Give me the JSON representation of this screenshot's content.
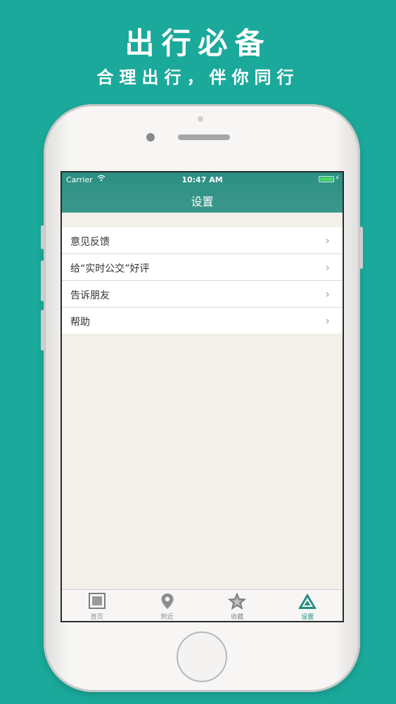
{
  "promo": {
    "headline": "出行必备",
    "subline": "合理出行，伴你同行"
  },
  "status_bar": {
    "carrier": "Carrier",
    "time": "10:47 AM",
    "battery_level": 1.0,
    "battery_color": "#4cd964"
  },
  "nav": {
    "title": "设置",
    "color": "#2b8f83"
  },
  "settings": {
    "items": [
      {
        "label": "意见反馈",
        "icon": "chevron-right-icon"
      },
      {
        "label": "给“实时公交”好评",
        "icon": "chevron-right-icon"
      },
      {
        "label": "告诉朋友",
        "icon": "chevron-right-icon"
      },
      {
        "label": "帮助",
        "icon": "chevron-right-icon"
      }
    ]
  },
  "tab_bar": {
    "tabs": [
      {
        "label": "首页",
        "icon": "home-square-icon",
        "active": false
      },
      {
        "label": "附近",
        "icon": "location-pin-icon",
        "active": false
      },
      {
        "label": "收藏",
        "icon": "star-icon",
        "active": false
      },
      {
        "label": "设置",
        "icon": "triangle-icon",
        "active": true
      }
    ],
    "active_color": "#1f8f80"
  }
}
